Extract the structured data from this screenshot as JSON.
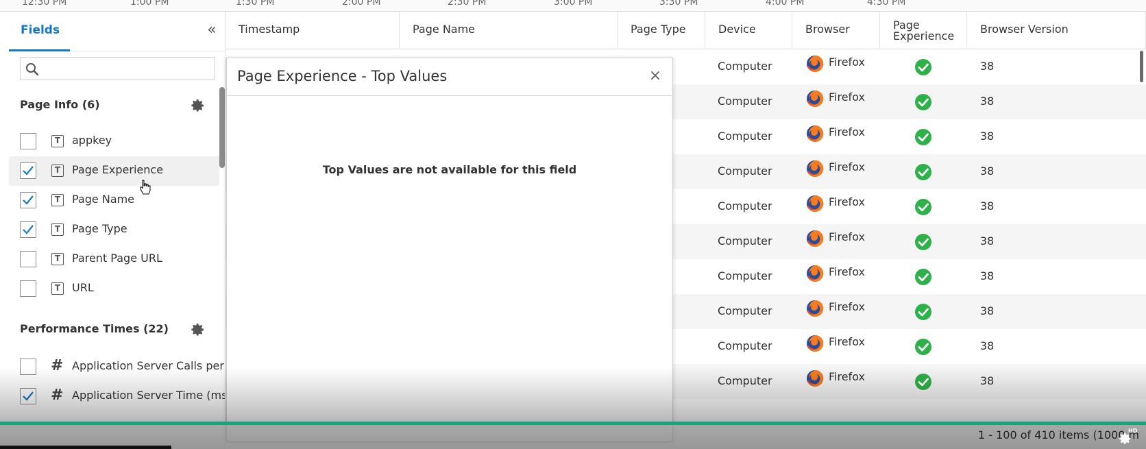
{
  "timeline": {
    "ticks": [
      "12:30 PM",
      "1:00 PM",
      "1:30 PM",
      "2:00 PM",
      "2:30 PM",
      "3:00 PM",
      "3:30 PM",
      "4:00 PM",
      "4:30 PM"
    ]
  },
  "fields_panel": {
    "tab_label": "Fields",
    "collapse_icon": "double-chevron-left-icon",
    "search_placeholder": "",
    "groups": [
      {
        "title": "Page Info (6)",
        "fields": [
          {
            "label": "appkey",
            "checked": false,
            "type": "text"
          },
          {
            "label": "Page Experience",
            "checked": true,
            "type": "text"
          },
          {
            "label": "Page Name",
            "checked": true,
            "type": "text"
          },
          {
            "label": "Page Type",
            "checked": true,
            "type": "text"
          },
          {
            "label": "Parent Page URL",
            "checked": false,
            "type": "text"
          },
          {
            "label": "URL",
            "checked": false,
            "type": "text"
          }
        ]
      },
      {
        "title": "Performance Times (22)",
        "fields": [
          {
            "label": "Application Server Calls per M",
            "checked": false,
            "type": "number"
          },
          {
            "label": "Application Server Time (ms)",
            "checked": true,
            "type": "number"
          }
        ]
      }
    ]
  },
  "table": {
    "headers": [
      "Timestamp",
      "Page Name",
      "Page Type",
      "Device",
      "Browser",
      "Page Experience",
      "Browser Version"
    ],
    "rows": [
      {
        "device": "Computer",
        "browser": "Firefox",
        "version": "38"
      },
      {
        "device": "Computer",
        "browser": "Firefox",
        "version": "38"
      },
      {
        "device": "Computer",
        "browser": "Firefox",
        "version": "38"
      },
      {
        "device": "Computer",
        "browser": "Firefox",
        "version": "38"
      },
      {
        "device": "Computer",
        "browser": "Firefox",
        "version": "38"
      },
      {
        "device": "Computer",
        "browser": "Firefox",
        "version": "38"
      },
      {
        "device": "Computer",
        "browser": "Firefox",
        "version": "38"
      },
      {
        "device": "Computer",
        "browser": "Firefox",
        "version": "38"
      },
      {
        "device": "Computer",
        "browser": "Firefox",
        "version": "38"
      },
      {
        "device": "Computer",
        "browser": "Firefox",
        "version": "38"
      }
    ],
    "pager": "1 - 100 of 410 items (1000 m"
  },
  "modal": {
    "title": "Page Experience - Top Values",
    "close_glyph": "×",
    "message": "Top Values are not available for this field"
  },
  "colors": {
    "accent": "#1478c8",
    "success": "#2fb14a",
    "progress": "#15a37a"
  }
}
